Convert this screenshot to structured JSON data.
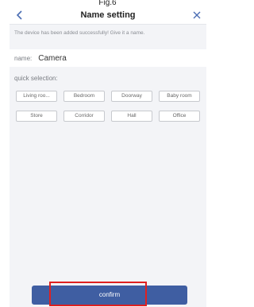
{
  "figure_label": "Fig.6",
  "header": {
    "title": "Name setting",
    "back_icon": "chevron-left-icon",
    "close_icon": "close-icon"
  },
  "notice_text": "The device has been added successfully! Give it a name.",
  "name_field": {
    "label": "name:",
    "value": "Camera"
  },
  "quick_selection": {
    "label": "quick selection:",
    "options": [
      "Living roo...",
      "Bedroom",
      "Doorway",
      "Baby room",
      "Store",
      "Corridor",
      "Hall",
      "Office"
    ]
  },
  "confirm_label": "confirm",
  "colors": {
    "accent": "#3f5ea2",
    "highlight": "#e02020",
    "icon": "#4a6db3"
  }
}
